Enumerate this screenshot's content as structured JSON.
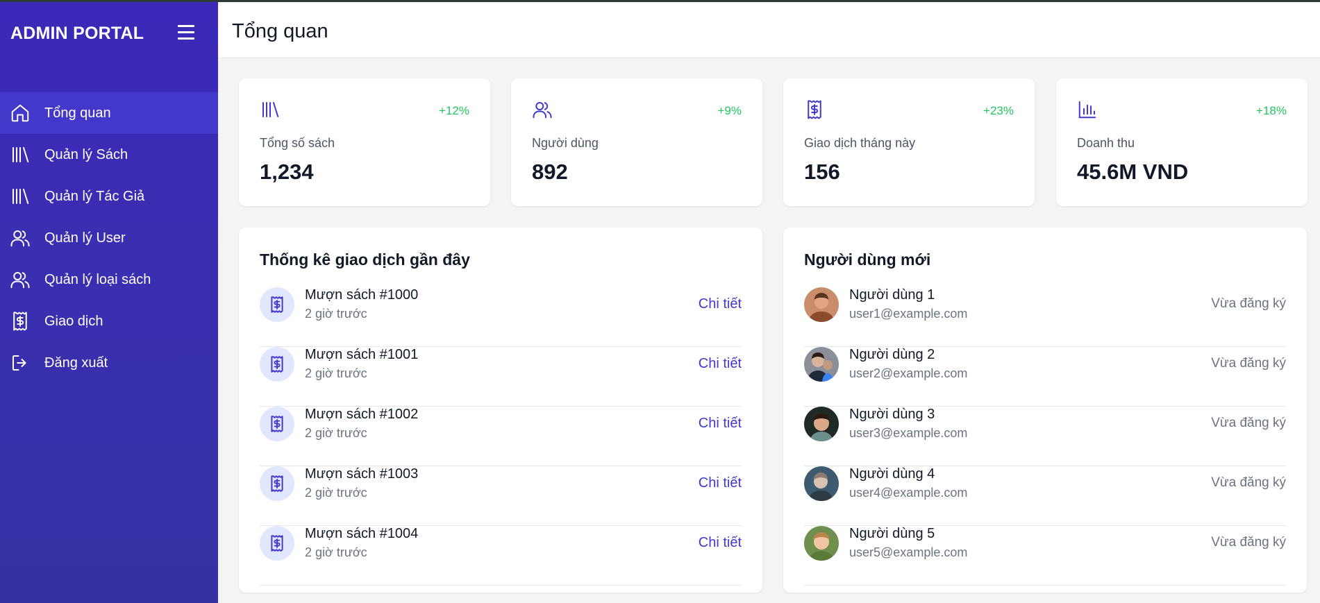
{
  "sidebar": {
    "brand": "ADMIN PORTAL",
    "menu_icon": "hamburger-icon",
    "items": [
      {
        "label": "Tổng quan",
        "icon": "home-icon",
        "active": true
      },
      {
        "label": "Quản lý Sách",
        "icon": "library-icon"
      },
      {
        "label": "Quản lý Tác Giả",
        "icon": "library-icon"
      },
      {
        "label": "Quản lý User",
        "icon": "users-icon"
      },
      {
        "label": "Quản lý loại sách",
        "icon": "users-icon"
      },
      {
        "label": "Giao dịch",
        "icon": "receipt-icon"
      },
      {
        "label": "Đăng xuất",
        "icon": "logout-icon"
      }
    ]
  },
  "header": {
    "title": "Tổng quan"
  },
  "stats": [
    {
      "label": "Tổng số sách",
      "value": "1,234",
      "trend": "+12%",
      "icon": "library-icon"
    },
    {
      "label": "Người dùng",
      "value": "892",
      "trend": "+9%",
      "icon": "users-icon"
    },
    {
      "label": "Giao dịch tháng này",
      "value": "156",
      "trend": "+23%",
      "icon": "receipt-icon"
    },
    {
      "label": "Doanh thu",
      "value": "45.6M VND",
      "trend": "+18%",
      "icon": "bar-chart-icon"
    }
  ],
  "transactions": {
    "title": "Thống kê giao dịch gần đây",
    "rows": [
      {
        "title": "Mượn sách #1000",
        "time": "2 giờ trước",
        "action": "Chi tiết"
      },
      {
        "title": "Mượn sách #1001",
        "time": "2 giờ trước",
        "action": "Chi tiết"
      },
      {
        "title": "Mượn sách #1002",
        "time": "2 giờ trước",
        "action": "Chi tiết"
      },
      {
        "title": "Mượn sách #1003",
        "time": "2 giờ trước",
        "action": "Chi tiết"
      },
      {
        "title": "Mượn sách #1004",
        "time": "2 giờ trước",
        "action": "Chi tiết"
      }
    ]
  },
  "new_users": {
    "title": "Người dùng mới",
    "rows": [
      {
        "name": "Người dùng 1",
        "email": "user1@example.com",
        "status": "Vừa đăng ký"
      },
      {
        "name": "Người dùng 2",
        "email": "user2@example.com",
        "status": "Vừa đăng ký"
      },
      {
        "name": "Người dùng 3",
        "email": "user3@example.com",
        "status": "Vừa đăng ký"
      },
      {
        "name": "Người dùng 4",
        "email": "user4@example.com",
        "status": "Vừa đăng ký"
      },
      {
        "name": "Người dùng 5",
        "email": "user5@example.com",
        "status": "Vừa đăng ký"
      }
    ]
  },
  "colors": {
    "sidebar": "#3a2fb0",
    "sidebar_active": "#4338ca",
    "accent": "#4338ca",
    "trend_positive": "#22c55e",
    "background": "#f3f4f6"
  }
}
